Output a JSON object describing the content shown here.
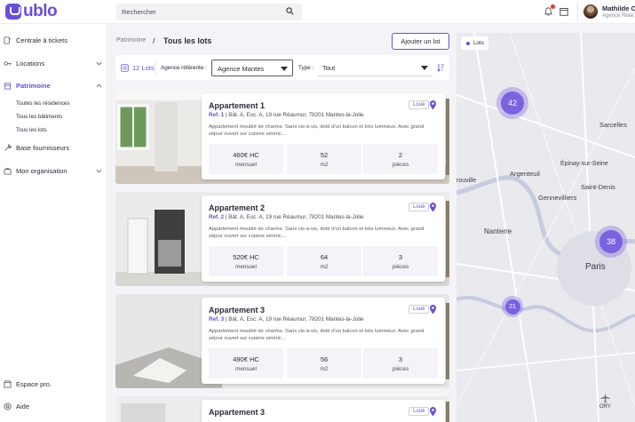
{
  "app": {
    "logo_text": "ublo"
  },
  "header": {
    "search_placeholder": "Rechercher",
    "user_name": "Mathilde C",
    "user_agency": "Agence Relai"
  },
  "sidebar": {
    "items": [
      {
        "label": "Centrale à tickets"
      },
      {
        "label": "Locations"
      },
      {
        "label": "Patrimoine"
      },
      {
        "label": "Base fournisseurs"
      },
      {
        "label": "Mon organisation"
      }
    ],
    "subitems": [
      {
        "label": "Toutes les résidences"
      },
      {
        "label": "Tous les bâtiments"
      },
      {
        "label": "Tous les lots"
      }
    ],
    "footer": [
      {
        "label": "Espace pro."
      },
      {
        "label": "Aide"
      }
    ]
  },
  "breadcrumb": {
    "parent": "Patrimoine",
    "separator": "/",
    "current": "Tous les lots"
  },
  "toolbar": {
    "add_label": "Ajouter un lot"
  },
  "filters": {
    "count": "12 Lots",
    "agence_label": "Agence référente :",
    "agence_value": "Agence Mantes",
    "type_label": "Type :",
    "type_value": "Tout"
  },
  "lots": [
    {
      "title": "Appartement 1",
      "ref": "Ref. 1",
      "address": "Bât. A, Esc. A, 19 rue Réaumur, 78201 Mantes-la-Jolie",
      "status": "Loué",
      "description": "Appartement meublé de charme. Sans vis-à-vis, doté d'un balcon et très lumineux. Avec grand séjour ouvert sur cuisine améric...",
      "price": "460€ HC",
      "price_unit": "mensuel",
      "area": "52",
      "area_unit": "m2",
      "rooms": "2",
      "rooms_unit": "pièces"
    },
    {
      "title": "Appartement 2",
      "ref": "Ref. 2",
      "address": "Bât. A, Esc. A, 19 rue Réaumur, 78201 Mantes-la-Jolie",
      "status": "Loué",
      "description": "Appartement meublé de charme. Sans vis-à-vis, doté d'un balcon et très lumineux. Avec grand séjour ouvert sur cuisine améric...",
      "price": "520€ HC",
      "price_unit": "mensuel",
      "area": "64",
      "area_unit": "m2",
      "rooms": "3",
      "rooms_unit": "pièces"
    },
    {
      "title": "Appartement 3",
      "ref": "Ref. 3",
      "address": "Bât. A, Esc. A, 19 rue Réaumur, 78201 Mantes-la-Jolie",
      "status": "Loué",
      "description": "Appartement meublé de charme. Sans vis-à-vis, doté d'un balcon et très lumineux. Avec grand séjour ouvert sur cuisine améric...",
      "price": "490€ HC",
      "price_unit": "mensuel",
      "area": "56",
      "area_unit": "m2",
      "rooms": "3",
      "rooms_unit": "pièces"
    },
    {
      "title": "Appartement 3",
      "status": "Loué"
    }
  ],
  "map": {
    "layer_label": "Lots",
    "clusters": [
      {
        "count": "42"
      },
      {
        "count": "38"
      },
      {
        "count": "21"
      }
    ],
    "cities": [
      "Sarcelles",
      "Épinay-sur-Seine",
      "Argenteuil",
      "Saint-Denis",
      "Gennevilliers",
      "Nanterre",
      "Paris",
      "rouville",
      "ORY"
    ]
  },
  "colors": {
    "accent": "#6a4fd8",
    "cluster": "#7a62e0",
    "notification": "#e53935"
  }
}
